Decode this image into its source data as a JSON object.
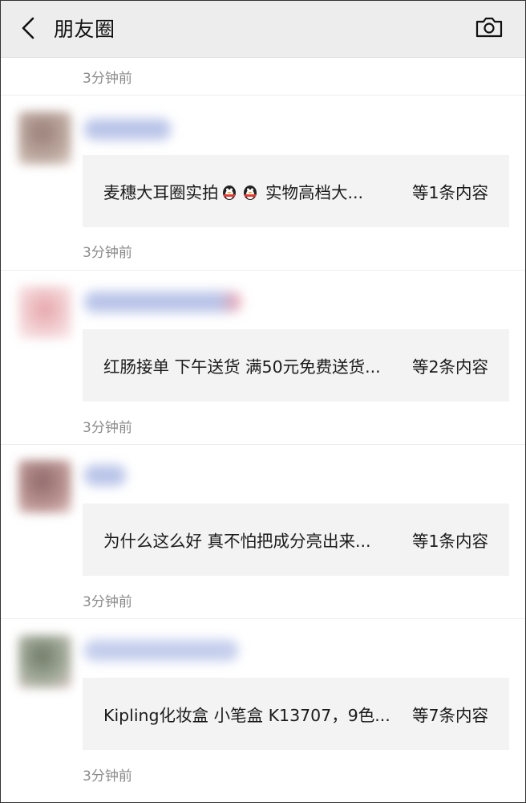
{
  "header": {
    "title": "朋友圈"
  },
  "top_timestamp": "3分钟前",
  "posts": [
    {
      "text": "麦穗大耳圈实拍",
      "text_after": " 实物高档大...",
      "emoji": "qq-penguin",
      "count": "等1条内容",
      "time": "3分钟前"
    },
    {
      "text": "红肠接单 下午送货 满50元免费送货...",
      "count": "等2条内容",
      "time": "3分钟前"
    },
    {
      "text": "为什么这么好 真不怕把成分亮出来...",
      "count": "等1条内容",
      "time": "3分钟前"
    },
    {
      "text": "Kipling化妆盒 小笔盒 K13707，9色...",
      "count": "等7条内容",
      "time": "3分钟前"
    }
  ]
}
